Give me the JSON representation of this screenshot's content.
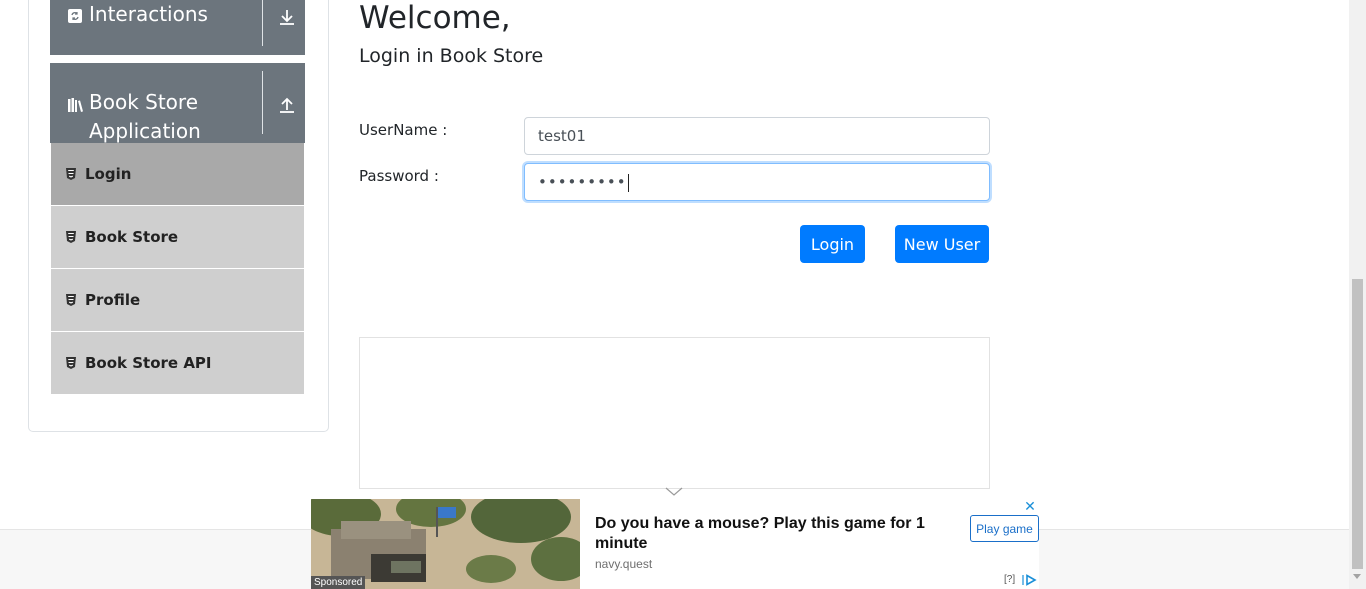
{
  "sidebar": {
    "groups": [
      {
        "label": "Interactions",
        "icon": "interactions-icon",
        "state": "collapsed"
      },
      {
        "label_line1": "Book Store",
        "label_line2": "Application",
        "icon": "book-icon",
        "state": "expanded"
      }
    ],
    "items": [
      {
        "label": "Login",
        "active": true
      },
      {
        "label": "Book Store"
      },
      {
        "label": "Profile"
      },
      {
        "label": "Book Store API"
      }
    ]
  },
  "main": {
    "title": "Welcome,",
    "subtitle": "Login in Book Store",
    "username_label": "UserName :",
    "username_value": "test01",
    "password_label": "Password :",
    "password_value": "•••••••••",
    "login_button": "Login",
    "new_user_button": "New User"
  },
  "ad": {
    "sponsored": "Sponsored",
    "headline": "Do you have a mouse? Play this game for 1 minute",
    "domain": "navy.quest",
    "cta": "Play game",
    "close": "✕",
    "help": "[?]"
  },
  "colors": {
    "primary": "#007bff",
    "sidebar_header": "#6c757d",
    "menu_item": "#cfcfcf",
    "menu_item_active": "#a9a9a9"
  }
}
